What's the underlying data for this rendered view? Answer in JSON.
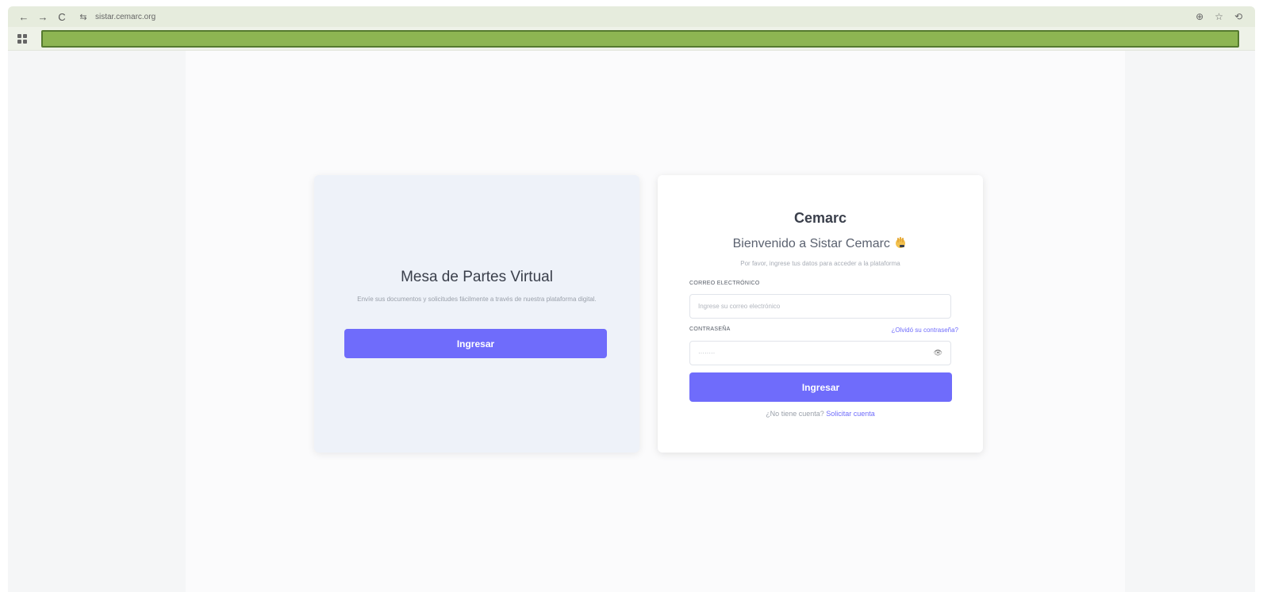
{
  "browser": {
    "url": "sistar.cemarc.org",
    "back_icon": "←",
    "forward_icon": "→",
    "reload_icon": "C",
    "site_info_icon": "⇆",
    "translate_icon": "⊕",
    "star_icon": "☆",
    "profile_icon": "⟲"
  },
  "left_card": {
    "title": "Mesa de Partes Virtual",
    "description": "Envíe sus documentos y solicitudes fácilmente a través de nuestra plataforma digital.",
    "button_label": "Ingresar"
  },
  "right_card": {
    "brand": "Cemarc",
    "welcome": "Bienvenido a Sistar Cemarc",
    "subtext": "Por favor, ingrese tus datos para acceder a la plataforma",
    "email_label": "CORREO ELECTRÓNICO",
    "email_placeholder": "Ingrese su correo electrónico",
    "password_label": "CONTRASEÑA",
    "forgot_link": "¿Olvidó su contraseña?",
    "password_value": "········",
    "eye_icon": "👁",
    "button_label": "Ingresar",
    "no_account_text": "¿No tiene cuenta?",
    "request_link": "Solicitar cuenta"
  },
  "colors": {
    "primary": "#6f6cfb",
    "bookmark_strip": "#8db552"
  }
}
